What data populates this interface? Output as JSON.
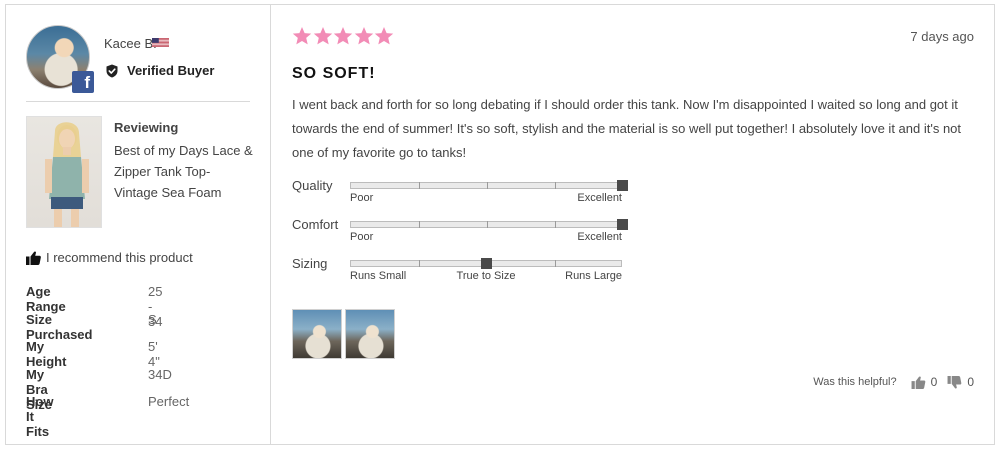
{
  "reviewer": {
    "name": "Kacee B.",
    "verified_label": "Verified Buyer",
    "country_flag": "us-flag-icon",
    "social_badge": "facebook-icon"
  },
  "product": {
    "reviewing_label": "Reviewing",
    "name": "Best of my Days Lace & Zipper Tank Top- Vintage Sea Foam"
  },
  "recommendation": "I recommend this product",
  "attributes": [
    {
      "key": "Age Range",
      "value": "25 - 34"
    },
    {
      "key": "Size Purchased",
      "value": "S"
    },
    {
      "key": "My Height",
      "value": "5' 4\""
    },
    {
      "key": "My Bra Size",
      "value": "34D"
    },
    {
      "key": "How It Fits",
      "value": "Perfect"
    }
  ],
  "review": {
    "rating": 5,
    "rating_max": 5,
    "date": "7 days ago",
    "title": "SO SOFT!",
    "body": "I went back and forth for so long debating if I should order this tank. Now I'm disappointed I waited so long and got it towards the end of summer! It's so soft, stylish and the material is so well put together! I absolutely love it and it's not one of my favorite go to tanks!"
  },
  "sliders": [
    {
      "label": "Quality",
      "min": "Poor",
      "mid": "",
      "max": "Excellent",
      "level": 1.0
    },
    {
      "label": "Comfort",
      "min": "Poor",
      "mid": "",
      "max": "Excellent",
      "level": 1.0
    },
    {
      "label": "Sizing",
      "min": "Runs Small",
      "mid": "True to Size",
      "max": "Runs Large",
      "level": 0.5
    }
  ],
  "helpful": {
    "question": "Was this helpful?",
    "up_count": "0",
    "down_count": "0"
  },
  "colors": {
    "star": "#f28cb6",
    "facebook": "#3b5998",
    "marker": "#4a4a4a"
  }
}
